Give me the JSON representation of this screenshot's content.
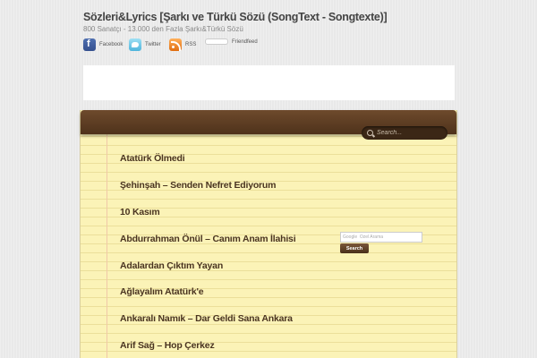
{
  "header": {
    "title": "Sözleri&Lyrics [Şarkı ve Türkü Sözü (SongText - Songtexte)]",
    "description": "800 Sanatçı - 13.000 den Fazla Şarkı&Türkü Sözü"
  },
  "social": [
    {
      "label": "Facebook",
      "icon": "facebook-icon"
    },
    {
      "label": "Twitter",
      "icon": "twitter-icon"
    },
    {
      "label": "RSS",
      "icon": "rss-icon"
    },
    {
      "label": "Friendfeed",
      "icon": "friendfeed-icon"
    }
  ],
  "search": {
    "placeholder": "Search..."
  },
  "posts": [
    "Atatürk Ölmedi",
    "Şehinşah – Senden Nefret Ediyorum",
    "10 Kasım",
    "Abdurrahman Önül – Canım Anam İlahisi",
    "Adalardan Çıktım Yayan",
    "Ağlayalım Atatürk'e",
    "Ankaralı Namık – Dar Geldi Sana Ankara",
    "Arif Sağ – Hop Çerkez"
  ],
  "google_search": {
    "placeholder": "Google  Özel Arama",
    "button_label": "Search"
  },
  "colors": {
    "header_brown": "#5a3c22",
    "paper": "#fbf3b7",
    "post_text": "#4a3420"
  }
}
